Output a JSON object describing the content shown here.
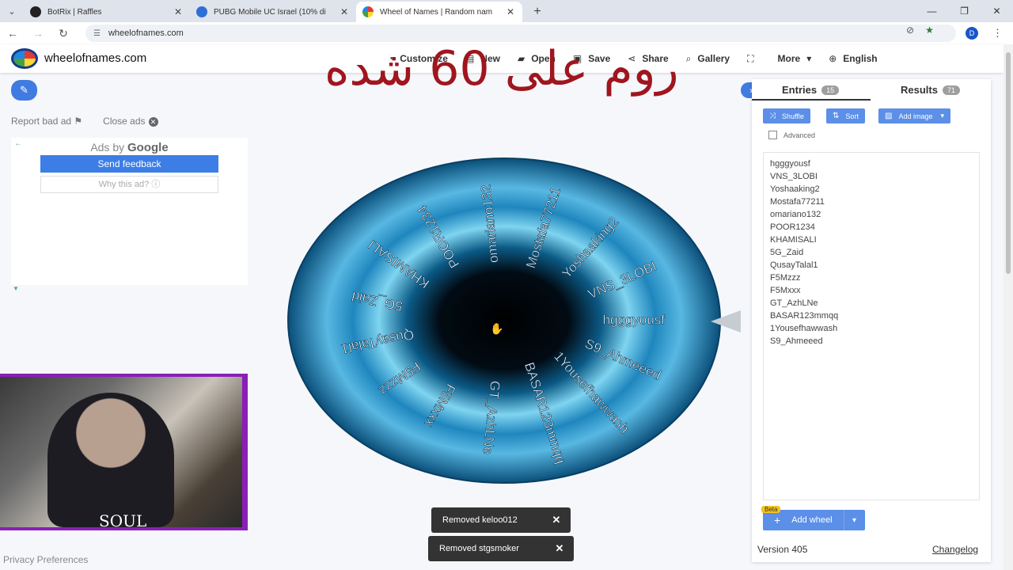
{
  "browser": {
    "tabs": [
      {
        "title": "BotRix | Raffles",
        "favicon_color": "#222222"
      },
      {
        "title": "PUBG Mobile UC Israel (10% di",
        "favicon_color": "#2d6fd6"
      },
      {
        "title": "Wheel of Names | Random nam",
        "favicon_color": "#e53935"
      }
    ],
    "url": "wheelofnames.com",
    "profile_initial": "D"
  },
  "site": {
    "brand": "wheelofnames.com",
    "nav": [
      {
        "label": "Customize",
        "icon": "palette-icon"
      },
      {
        "label": "New",
        "icon": "file-icon"
      },
      {
        "label": "Open",
        "icon": "folder-open-icon"
      },
      {
        "label": "Save",
        "icon": "save-icon"
      },
      {
        "label": "Share",
        "icon": "share-icon"
      },
      {
        "label": "Gallery",
        "icon": "search-icon"
      },
      {
        "label": "",
        "icon": "fullscreen-icon"
      },
      {
        "label": "More",
        "icon": "chevron-down-icon"
      },
      {
        "label": "English",
        "icon": "globe-icon"
      }
    ]
  },
  "overlay": {
    "text": "روم على 60 شده"
  },
  "ads": {
    "report_label": "Report bad ad",
    "close_label": "Close ads",
    "ads_by": "Ads by",
    "google": "Google",
    "send_feedback": "Send feedback",
    "why_this_ad": "Why this ad?"
  },
  "webcam": {
    "caption": "SOUL"
  },
  "wheel": {
    "segments": [
      "hgggyousf",
      "VNS_3LOBI",
      "Yoshaaking2",
      "Mostafa77211",
      "omariano132",
      "POOR1234",
      "KHAMISALI",
      "5G_Zaid",
      "QusayTalal1",
      "F5Mzzz",
      "F5Mxxx",
      "GT_AzhLNe",
      "BASAR123mmqq",
      "1Yousefhawwash",
      "S9_Ahmeeed"
    ]
  },
  "toasts": [
    {
      "text": "Removed keloo012"
    },
    {
      "text": "Removed stgsmoker"
    }
  ],
  "panel": {
    "entries_tab": "Entries",
    "entries_count": "15",
    "results_tab": "Results",
    "results_count": "71",
    "shuffle": "Shuffle",
    "sort": "Sort",
    "add_image": "Add image",
    "advanced": "Advanced",
    "entries": [
      "hgggyousf",
      "VNS_3LOBI",
      "Yoshaaking2",
      "Mostafa77211",
      "omariano132",
      "POOR1234",
      "KHAMISALI",
      "5G_Zaid",
      "QusayTalal1",
      "F5Mzzz",
      "F5Mxxx",
      "GT_AzhLNe",
      "BASAR123mmqq",
      "1Yousefhawwash",
      "S9_Ahmeeed"
    ],
    "beta": "Beta",
    "add_wheel": "Add wheel",
    "version": "Version 405",
    "changelog": "Changelog"
  },
  "footer": {
    "privacy": "Privacy Preferences"
  },
  "colors": {
    "accent": "#3f7be0",
    "overlay_text": "#a0151e",
    "webcam_border": "#8a1fb8"
  }
}
